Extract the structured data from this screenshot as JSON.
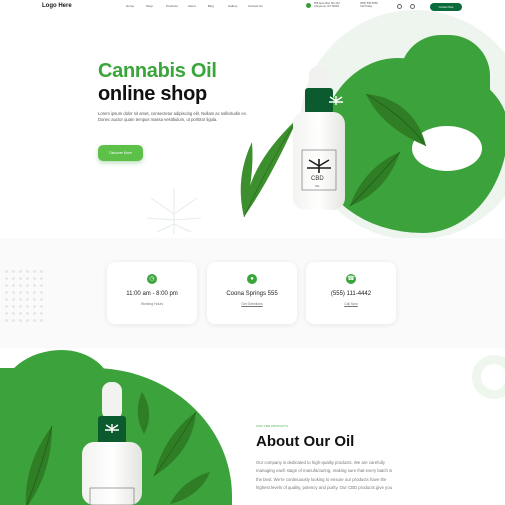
{
  "header": {
    "logo": "Logo Here",
    "nav": [
      "Home",
      "Shop",
      "Products",
      "About",
      "Blog",
      "Gallery",
      "Contact Us"
    ],
    "address": [
      "555 Apex Ban Sho Rd",
      "Cheyenne, WY 82001"
    ],
    "phone": [
      "(555) 555-5555",
      "Call Today"
    ],
    "cta": "Contact Now"
  },
  "hero": {
    "title_line1": "Cannabis Oil",
    "title_line2": "online shop",
    "text": "Lorem ipsum dolor sit amet, consectetur adipiscing elit. Nullam ac sollicitudin ex. Donec auctor quam tempus massa vestibulum, ut porttitor ligula.",
    "button": "Discover More",
    "bottle_label": "CBD",
    "bottle_sublabel": "OIL"
  },
  "cards": [
    {
      "icon": "clock-icon",
      "title": "11:00 am - 8:00 pm",
      "sub": "Working Hours"
    },
    {
      "icon": "location-pin-icon",
      "title": "Coona Springs 555",
      "sub": "Get Directions"
    },
    {
      "icon": "phone-icon",
      "title": "(555) 111-4442",
      "sub": "Call Now"
    }
  ],
  "about": {
    "kicker": "OUR CBD PRODUCTS",
    "title": "About Our Oil",
    "text": "Our company is dedicated to high-quality products. We are carefully managing each stage of manufacturing, making sure that every batch is the best. We're continuously looking to ensure our products have the highest levels of quality, potency and purity. Our CBD products give you"
  },
  "colors": {
    "brand_green": "#3aa53a",
    "dark_green": "#0b6b3a",
    "light_green_bg": "#eef5ee"
  }
}
